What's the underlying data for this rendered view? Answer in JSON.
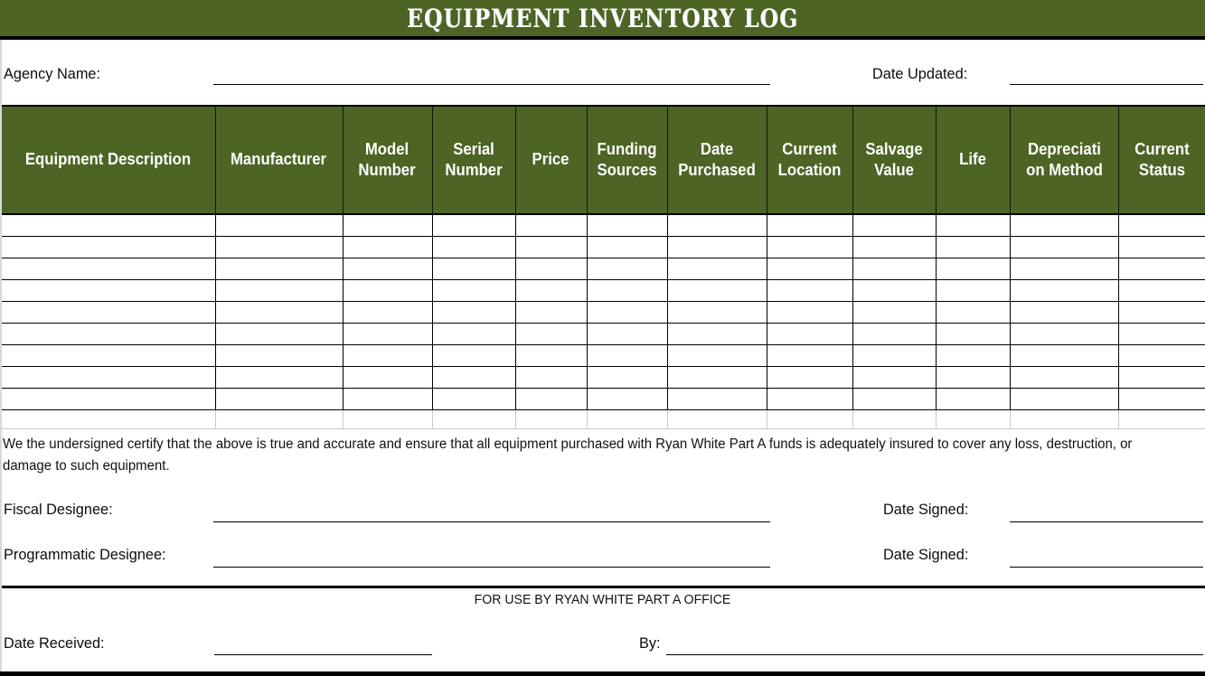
{
  "document": {
    "title": "Equipment Inventory Log",
    "accent_color": "#4D6425",
    "text_color": "#111111"
  },
  "meta": {
    "agency_label": "Agency Name:",
    "agency_value": "",
    "date_updated_label": "Date Updated:",
    "date_updated_value": ""
  },
  "table": {
    "columns": [
      "Equipment Description",
      "Manufacturer",
      "Model Number",
      "Serial Number",
      "Price",
      "Funding Sources",
      "Date Purchased",
      "Current Location",
      "Salvage Value",
      "Life",
      "Depreciati on Method",
      "Current Status"
    ],
    "column_lines": [
      [
        "Equipment Description"
      ],
      [
        "Manufacturer"
      ],
      [
        "Model",
        "Number"
      ],
      [
        "Serial",
        "Number"
      ],
      [
        "Price"
      ],
      [
        "Funding",
        "Sources"
      ],
      [
        "Date",
        "Purchased"
      ],
      [
        "Current",
        "Location"
      ],
      [
        "Salvage",
        "Value"
      ],
      [
        "Life"
      ],
      [
        "Depreciati",
        "on Method"
      ],
      [
        "Current",
        "Status"
      ]
    ],
    "empty_row_count": 9,
    "spacer_row_count": 1,
    "rows": []
  },
  "certification": {
    "text": "We the undersigned certify that the above is true and accurate and ensure that all equipment purchased with Ryan White Part A funds is adequately insured to cover any loss, destruction, or damage to such equipment."
  },
  "signatures": {
    "fiscal_label": "Fiscal Designee:",
    "fiscal_value": "",
    "fiscal_date_label": "Date Signed:",
    "fiscal_date_value": "",
    "programmatic_label": "Programmatic Designee:",
    "programmatic_value": "",
    "programmatic_date_label": "Date Signed:",
    "programmatic_date_value": ""
  },
  "office_use": {
    "heading": "FOR USE BY RYAN WHITE PART A OFFICE",
    "date_received_label": "Date Received:",
    "date_received_value": "",
    "by_label": "By:",
    "by_value": ""
  }
}
